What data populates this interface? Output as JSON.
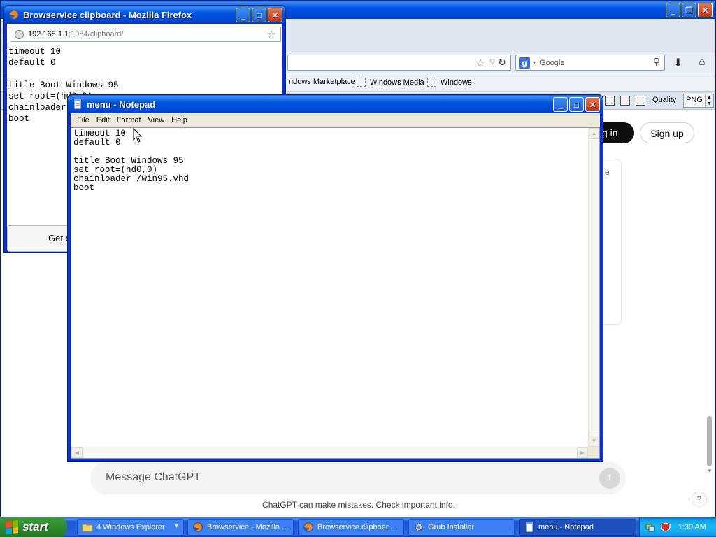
{
  "firefox_main": {
    "title": "",
    "search_placeholder": "Google",
    "bookmarks": [
      "ndows Marketplace",
      "Windows Media",
      "Windows"
    ],
    "quality_label": "Quality",
    "format_value": "PNG",
    "login_label": "g in",
    "signup_label": "Sign up",
    "card_fragment": "e",
    "message_placeholder": "Message ChatGPT",
    "footer_text": "ChatGPT can make mistakes. Check important info.",
    "help_label": "?"
  },
  "firefox_clip": {
    "title": "Browservice clipboard - Mozilla Firefox",
    "url_host": "192.168.1.1",
    "url_path": ":1984/clipboard/",
    "lines": [
      "timeout 10",
      "default 0",
      "",
      "title Boot Windows 95",
      "set root=(hd0,0)",
      "chainloader /win95.vhd",
      "boot"
    ],
    "button_label": "Get c"
  },
  "notepad": {
    "title": "menu - Notepad",
    "menus": [
      "File",
      "Edit",
      "Format",
      "View",
      "Help"
    ],
    "lines": [
      "timeout 10",
      "default 0",
      "",
      "title Boot Windows 95",
      "set root=(hd0,0)",
      "chainloader /win95.vhd",
      "boot"
    ]
  },
  "taskbar": {
    "start_label": "start",
    "tasks": [
      {
        "label": "4 Windows Explorer",
        "icon": "folder-icon"
      },
      {
        "label": "Browservice - Mozilla ...",
        "icon": "firefox-icon"
      },
      {
        "label": "Browservice clipboar...",
        "icon": "firefox-icon"
      },
      {
        "label": "Grub Installer",
        "icon": "gear-icon"
      },
      {
        "label": "menu - Notepad",
        "icon": "notepad-icon"
      }
    ],
    "clock": "1:39 AM"
  },
  "colors": {
    "xp_title_blue": "#0054e3",
    "taskbar_blue": "#2663e0",
    "start_green": "#2f8a2f",
    "close_red": "#c2350f"
  }
}
